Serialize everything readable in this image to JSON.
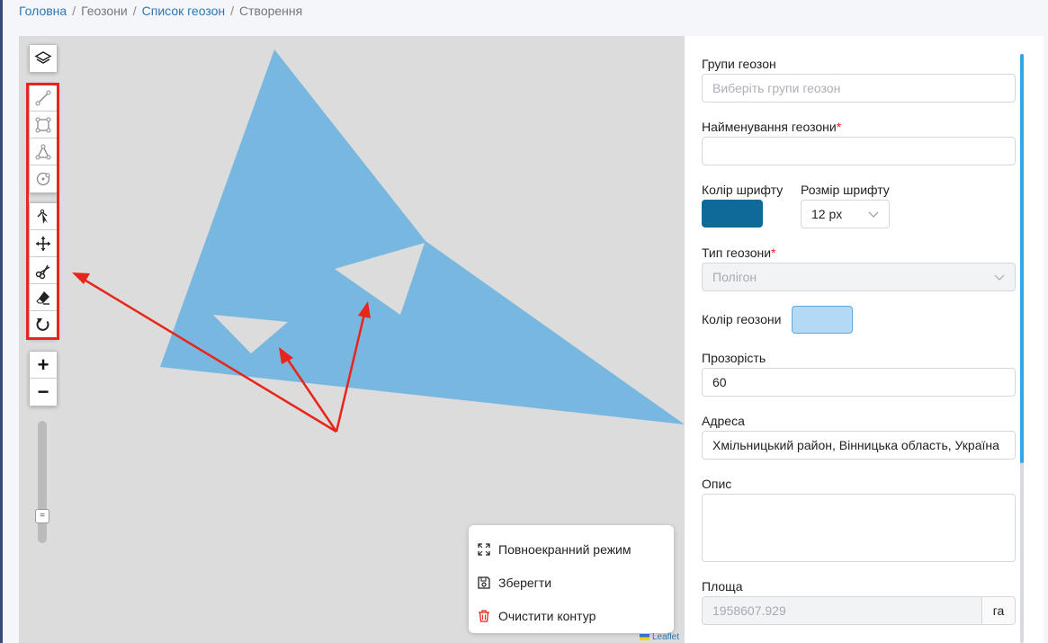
{
  "breadcrumb": {
    "items": [
      {
        "label": "Головна",
        "link": true
      },
      {
        "label": "Геозони",
        "link": false
      },
      {
        "label": "Список геозон",
        "link": true
      },
      {
        "label": "Створення",
        "link": false
      }
    ],
    "separator": "/"
  },
  "map": {
    "draw_tools": [
      "polyline-icon",
      "rectangle-icon",
      "polygon-icon",
      "circle-icon"
    ],
    "edit_tools": [
      "edit-cursor-icon",
      "move-icon",
      "cut-icon",
      "eraser-icon",
      "rotate-icon"
    ],
    "zoom_in": "+",
    "zoom_out": "−",
    "polygon_color": "#78b8e0",
    "annotation_color": "#e8251a",
    "menu": {
      "fullscreen": "Повноекранний режим",
      "save": "Зберегти",
      "clear": "Очистити контур"
    },
    "attribution": "Leaflet"
  },
  "form": {
    "groups": {
      "label": "Групи геозон",
      "placeholder": "Виберіть групи геозон"
    },
    "name": {
      "label": "Найменування геозони",
      "required": "*",
      "value": ""
    },
    "font_color": {
      "label": "Колір шрифту",
      "value": "#0f6a99"
    },
    "font_size": {
      "label": "Розмір шрифту",
      "value": "12 px"
    },
    "type": {
      "label": "Тип геозони",
      "required": "*",
      "value": "Полігон"
    },
    "geozone_color": {
      "label": "Колір геозони",
      "value": "#b3d9f5"
    },
    "opacity": {
      "label": "Прозорість",
      "value": "60"
    },
    "address": {
      "label": "Адреса",
      "value": "Хмільницький район, Вінницька область, Україна"
    },
    "description": {
      "label": "Опис",
      "value": ""
    },
    "area": {
      "label": "Площа",
      "value": "1958607.929",
      "unit": "га"
    }
  }
}
